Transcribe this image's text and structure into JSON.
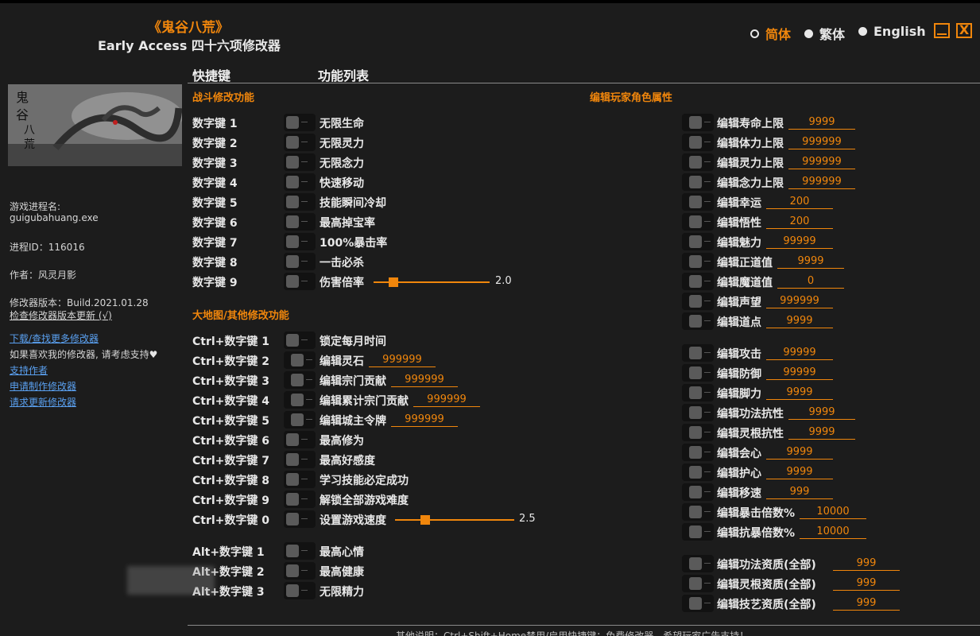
{
  "header": {
    "title_zh": "《鬼谷八荒》",
    "title_en": "Early Access 四十六项修改器",
    "langs": [
      "简体",
      "繁体",
      "English"
    ],
    "min_label": "_",
    "close_label": "X"
  },
  "columns": {
    "hotkey": "快捷键",
    "features": "功能列表"
  },
  "sidebar": {
    "process_label": "游戏进程名:",
    "process_name": "guigubahuang.exe",
    "pid": "进程ID：116016",
    "author": "作者：风灵月影",
    "version": "修改器版本：Build.2021.01.28",
    "check_update": "检查修改器版本更新 (√)",
    "links": [
      "下载/查找更多修改器",
      "如果喜欢我的修改器, 请考虑支持",
      "支持作者",
      "申请制作修改器",
      "请求更新修改器"
    ],
    "heart": "♥"
  },
  "combat": {
    "title": "战斗修改功能",
    "rows": [
      {
        "key": "数字键 1",
        "label": "无限生命"
      },
      {
        "key": "数字键 2",
        "label": "无限灵力"
      },
      {
        "key": "数字键 3",
        "label": "无限念力"
      },
      {
        "key": "数字键 4",
        "label": "快速移动"
      },
      {
        "key": "数字键 5",
        "label": "技能瞬间冷却"
      },
      {
        "key": "数字键 6",
        "label": "最高掉宝率"
      },
      {
        "key": "数字键 7",
        "label": "100%暴击率"
      },
      {
        "key": "数字键 8",
        "label": "一击必杀"
      },
      {
        "key": "数字键 9",
        "label": "伤害倍率"
      }
    ],
    "slider_value": "2.0",
    "slider_level": 0.17
  },
  "map": {
    "title": "大地图/其他修改功能",
    "rows": [
      {
        "key": "Ctrl+数字键 1",
        "label": "锁定每月时间"
      },
      {
        "key": "Ctrl+数字键 2",
        "label": "编辑灵石",
        "value": "999999"
      },
      {
        "key": "Ctrl+数字键 3",
        "label": "编辑宗门贡献",
        "value": "999999"
      },
      {
        "key": "Ctrl+数字键 4",
        "label": "编辑累计宗门贡献",
        "value": "999999"
      },
      {
        "key": "Ctrl+数字键 5",
        "label": "编辑城主令牌",
        "value": "999999"
      },
      {
        "key": "Ctrl+数字键 6",
        "label": "最高修为"
      },
      {
        "key": "Ctrl+数字键 7",
        "label": "最高好感度"
      },
      {
        "key": "Ctrl+数字键 8",
        "label": "学习技能必定成功"
      },
      {
        "key": "Ctrl+数字键 9",
        "label": "解锁全部游戏难度"
      },
      {
        "key": "Ctrl+数字键 0",
        "label": "设置游戏速度"
      }
    ],
    "slider_value": "2.5",
    "slider_level": 0.25,
    "alt_rows": [
      {
        "key": "Alt+数字键 1",
        "label": "最高心情"
      },
      {
        "key": "Alt+数字键 2",
        "label": "最高健康"
      },
      {
        "key": "Alt+数字键 3",
        "label": "无限精力"
      }
    ]
  },
  "player": {
    "title": "编辑玩家角色属性",
    "group1": [
      {
        "label": "编辑寿命上限",
        "value": "9999"
      },
      {
        "label": "编辑体力上限",
        "value": "999999"
      },
      {
        "label": "编辑灵力上限",
        "value": "999999"
      },
      {
        "label": "编辑念力上限",
        "value": "999999"
      },
      {
        "label": "编辑幸运",
        "value": "200"
      },
      {
        "label": "编辑悟性",
        "value": "200"
      },
      {
        "label": "编辑魅力",
        "value": "99999"
      },
      {
        "label": "编辑正道值",
        "value": "9999"
      },
      {
        "label": "编辑魔道值",
        "value": "0"
      },
      {
        "label": "编辑声望",
        "value": "999999"
      },
      {
        "label": "编辑道点",
        "value": "9999"
      }
    ],
    "group2": [
      {
        "label": "编辑攻击",
        "value": "99999"
      },
      {
        "label": "编辑防御",
        "value": "99999"
      },
      {
        "label": "编辑脚力",
        "value": "9999"
      },
      {
        "label": "编辑功法抗性",
        "value": "9999"
      },
      {
        "label": "编辑灵根抗性",
        "value": "9999"
      },
      {
        "label": "编辑会心",
        "value": "9999"
      },
      {
        "label": "编辑护心",
        "value": "9999"
      },
      {
        "label": "编辑移速",
        "value": "999"
      },
      {
        "label": "编辑暴击倍数%",
        "value": "10000"
      },
      {
        "label": "编辑抗暴倍数%",
        "value": "10000"
      }
    ],
    "group3": [
      {
        "label": "编辑功法资质(全部)",
        "value": "999"
      },
      {
        "label": "编辑灵根资质(全部)",
        "value": "999"
      },
      {
        "label": "编辑技艺资质(全部)",
        "value": "999"
      }
    ]
  },
  "footer": "其他说明：Ctrl+Shift+Home禁用/启用快捷键；免费修改器，希望玩家广告支持！",
  "colors": {
    "accent": "#f0860c",
    "bg": "#1c1c1c",
    "link": "#5aa0f0"
  }
}
